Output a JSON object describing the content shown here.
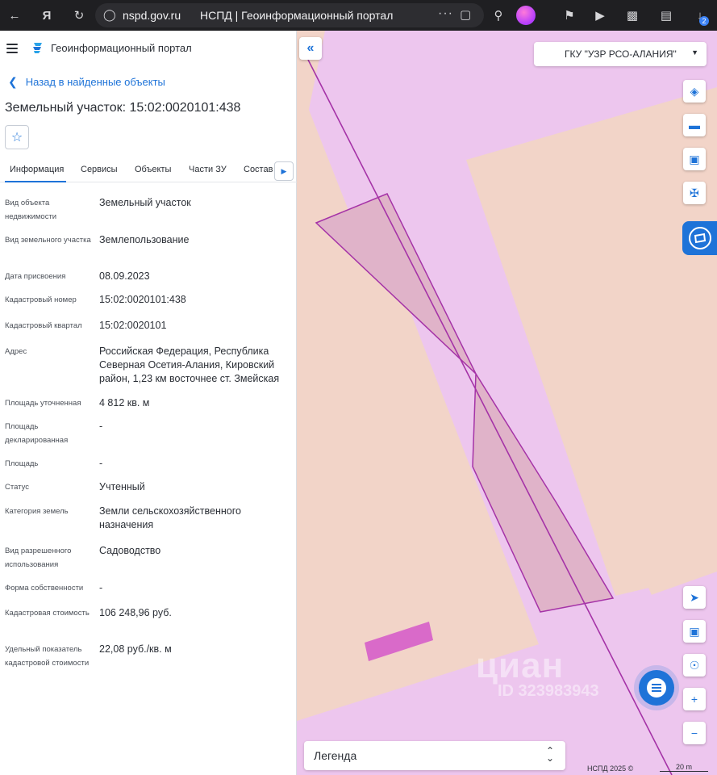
{
  "browser": {
    "domain": "nspd.gov.ru",
    "page_title": "НСПД | Геоинформационный портал",
    "downloads_count": "2"
  },
  "app": {
    "title": "Геоинформационный портал"
  },
  "nav": {
    "back_label": "Назад в найденные объекты"
  },
  "object": {
    "title": "Земельный участок: 15:02:0020101:438"
  },
  "tabs": [
    {
      "label": "Информация",
      "active": true
    },
    {
      "label": "Сервисы"
    },
    {
      "label": "Объекты"
    },
    {
      "label": "Части ЗУ"
    },
    {
      "label": "Состав"
    }
  ],
  "properties": [
    {
      "label": "Вид объекта недвижимости",
      "value": "Земельный участок"
    },
    {
      "label": "Вид земельного участка",
      "value": "Землепользование"
    },
    {
      "label": "Дата присвоения",
      "value": "08.09.2023"
    },
    {
      "label": "Кадастровый номер",
      "value": "15:02:0020101:438"
    },
    {
      "label": "Кадастровый квартал",
      "value": "15:02:0020101"
    },
    {
      "label": "Адрес",
      "value": "Российская Федерация, Республика Северная Осетия-Алания, Кировский район, 1,23 км восточнее ст. Змейская"
    },
    {
      "label": "Площадь уточненная",
      "value": "4 812 кв. м"
    },
    {
      "label": "Площадь декларированная",
      "value": "-"
    },
    {
      "label": "Площадь",
      "value": "-"
    },
    {
      "label": "Статус",
      "value": "Учтенный"
    },
    {
      "label": "Категория земель",
      "value": "Земли сельскохозяйственного назначения"
    },
    {
      "label": "Вид разрешенного использования",
      "value": "Садоводство"
    },
    {
      "label": "Форма собственности",
      "value": "-"
    },
    {
      "label": "Кадастровая стоимость",
      "value": "106 248,96 руб."
    },
    {
      "label": "Удельный показатель кадастровой стоимости",
      "value": "22,08 руб./кв. м"
    }
  ],
  "map": {
    "org_select": "ГКУ \"УЗР РСО-АЛАНИЯ\"",
    "legend_label": "Легенда",
    "copyright": "НСПД 2025 ©",
    "scale": "20 m",
    "watermark": "циан",
    "watermark_id": "ID 323983943",
    "colors": {
      "background": "#f2d4c8",
      "road": "#edc6ee",
      "parcel_fill": "#e0b3c9",
      "parcel_stroke": "#a533a7",
      "small_parcel": "#d96ac9",
      "accent": "#1e73d8"
    }
  }
}
